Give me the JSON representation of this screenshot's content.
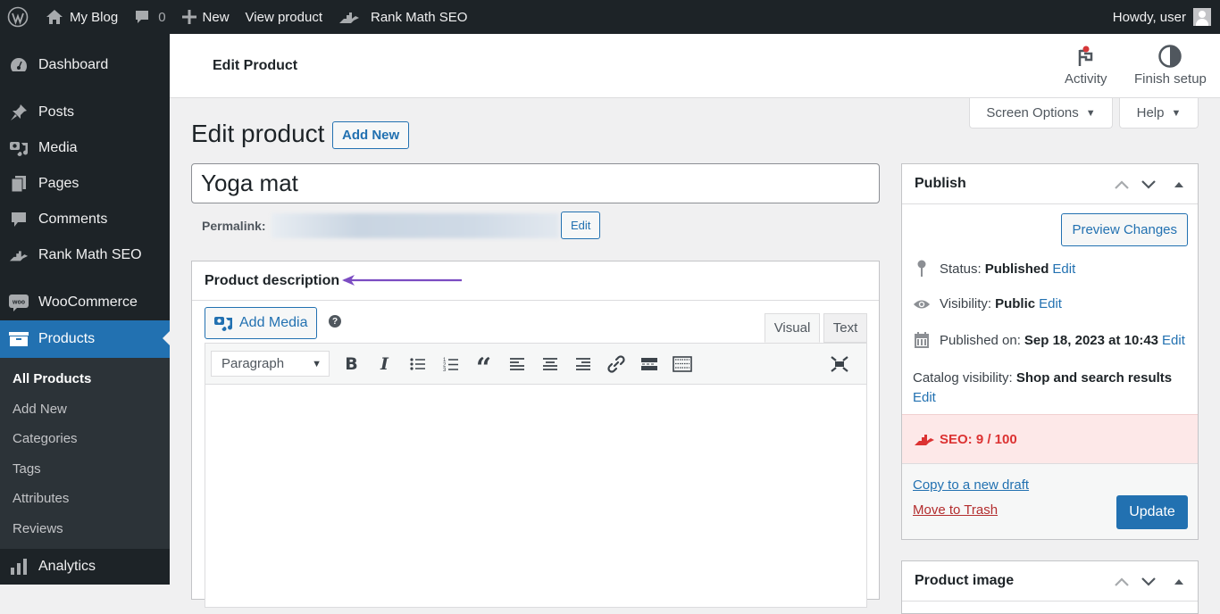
{
  "admin_bar": {
    "site_name": "My Blog",
    "comments_count": "0",
    "new_label": "New",
    "view_product_label": "View product",
    "rank_math_label": "Rank Math SEO",
    "greeting": "Howdy, user"
  },
  "sidebar": {
    "items": [
      {
        "label": "Dashboard",
        "icon": "dashboard-icon"
      },
      {
        "label": "Posts",
        "icon": "pin-icon"
      },
      {
        "label": "Media",
        "icon": "media-icon"
      },
      {
        "label": "Pages",
        "icon": "pages-icon"
      },
      {
        "label": "Comments",
        "icon": "comment-icon"
      },
      {
        "label": "Rank Math SEO",
        "icon": "rank-math-icon"
      },
      {
        "label": "WooCommerce",
        "icon": "woo-icon"
      },
      {
        "label": "Products",
        "icon": "archive-icon",
        "current": true
      },
      {
        "label": "Analytics",
        "icon": "bar-chart-icon"
      }
    ],
    "submenu": [
      {
        "label": "All Products",
        "active": true
      },
      {
        "label": "Add New"
      },
      {
        "label": "Categories"
      },
      {
        "label": "Tags"
      },
      {
        "label": "Attributes"
      },
      {
        "label": "Reviews"
      }
    ]
  },
  "wc_header": {
    "title": "Edit Product",
    "activity_label": "Activity",
    "finish_setup_label": "Finish setup"
  },
  "screen_meta": {
    "screen_options_label": "Screen Options",
    "help_label": "Help"
  },
  "page": {
    "title": "Edit product",
    "add_new_label": "Add New",
    "product_title_value": "Yoga mat",
    "permalink_label": "Permalink:",
    "permalink_edit_label": "Edit"
  },
  "description_box": {
    "heading": "Product description",
    "add_media_label": "Add Media",
    "help_glyph": "?",
    "tab_visual": "Visual",
    "tab_text": "Text",
    "format_value": "Paragraph",
    "annotation_color": "#7b4cc2"
  },
  "publish_box": {
    "heading": "Publish",
    "preview_label": "Preview Changes",
    "status_label": "Status:",
    "status_value": "Published",
    "visibility_label": "Visibility:",
    "visibility_value": "Public",
    "published_on_label": "Published on:",
    "published_on_value": "Sep 18, 2023 at 10:43",
    "catalog_label": "Catalog visibility:",
    "catalog_value": "Shop and search results",
    "edit_label": "Edit",
    "seo_label": "SEO: 9 / 100",
    "copy_draft_label": "Copy to a new draft",
    "trash_label": "Move to Trash",
    "update_label": "Update"
  },
  "product_image_box": {
    "heading": "Product image"
  },
  "colors": {
    "accent": "#2271b1",
    "admin_dark": "#1d2327",
    "seo_bad": "#dc3232",
    "trash": "#b32d2e"
  }
}
